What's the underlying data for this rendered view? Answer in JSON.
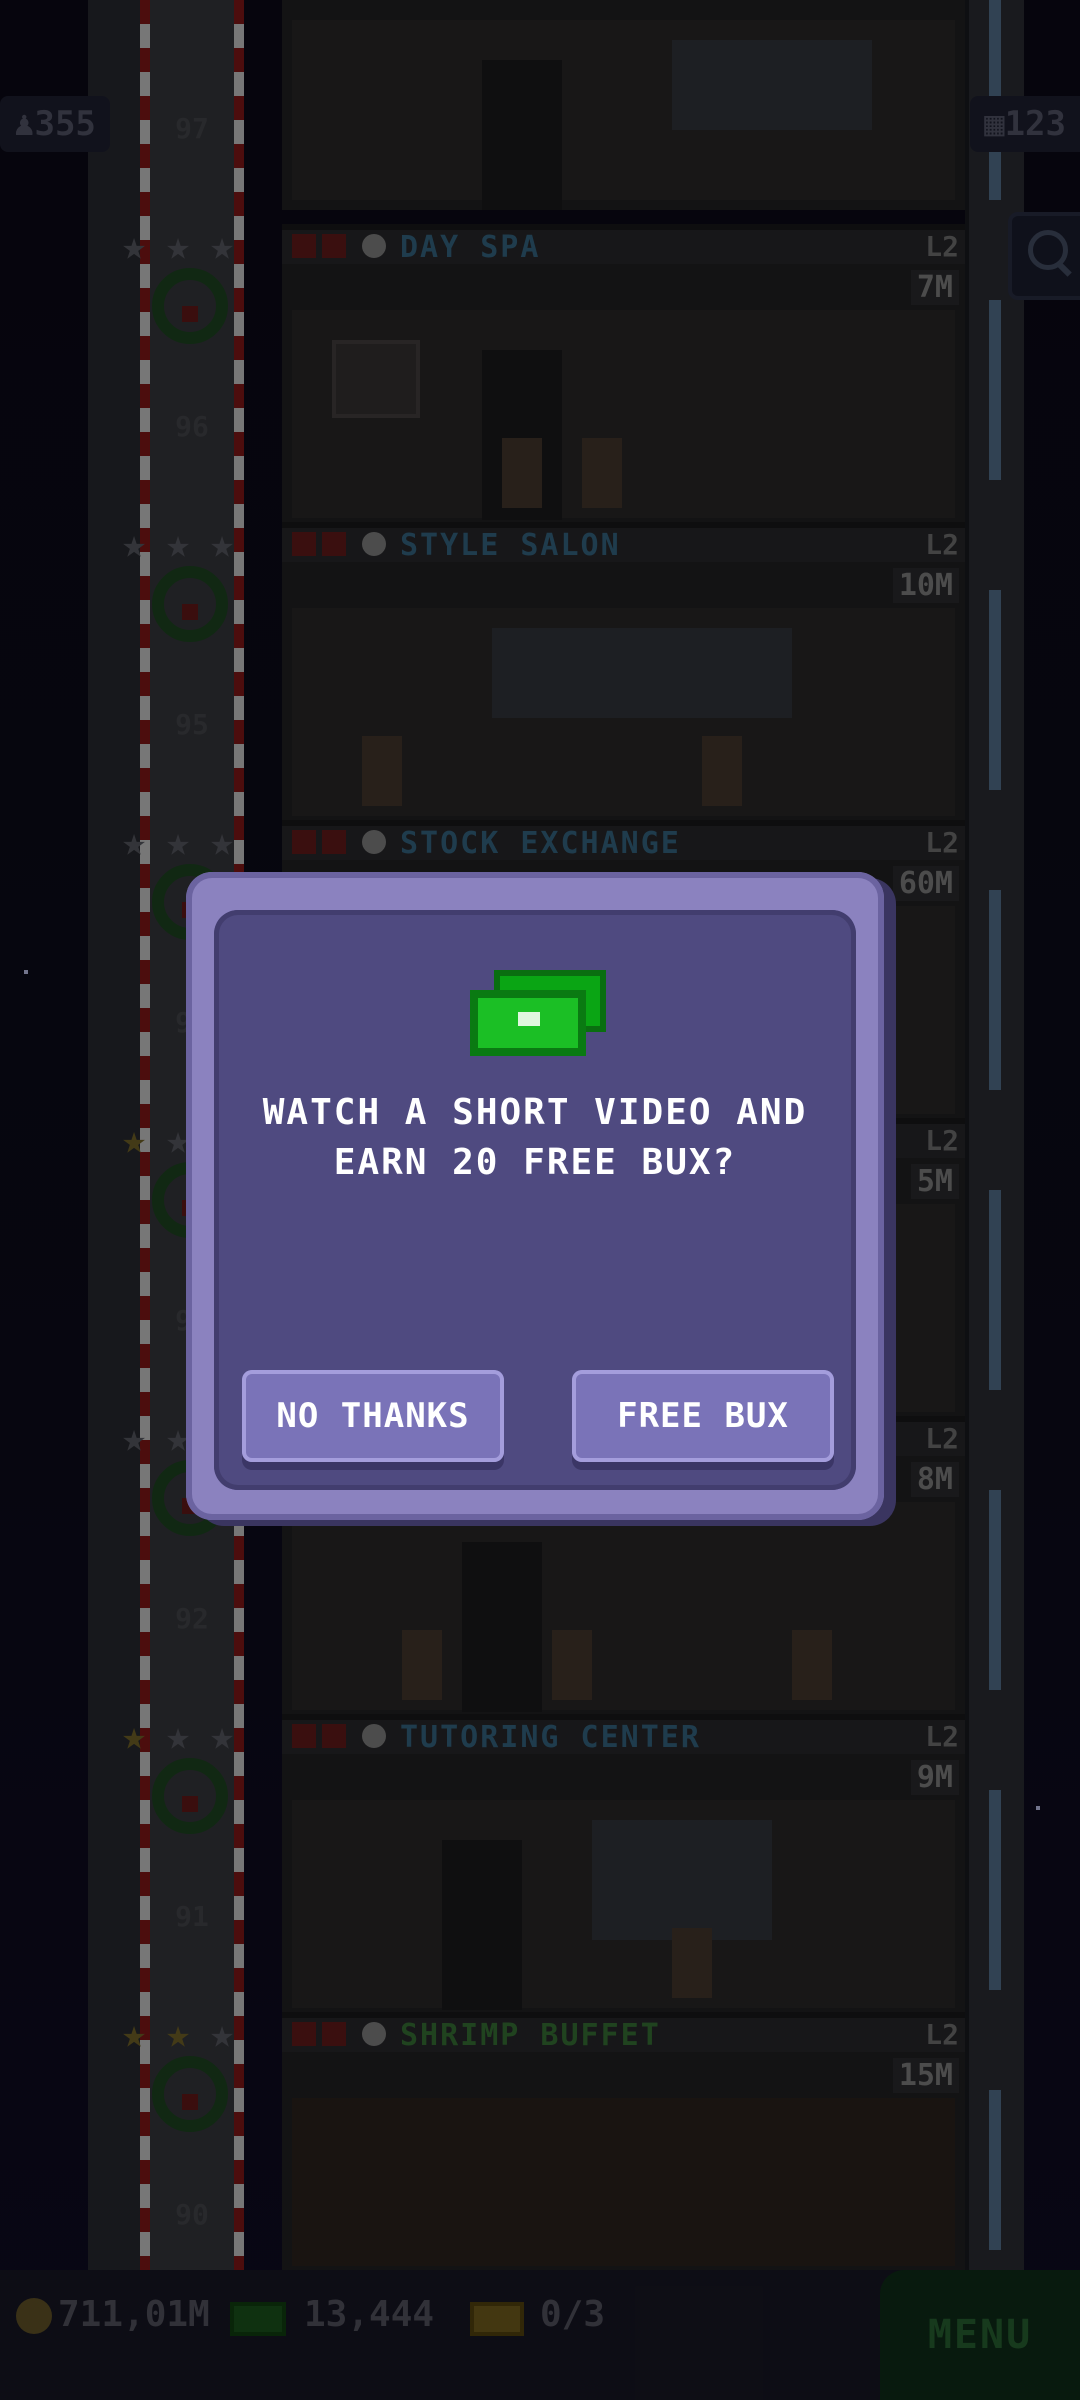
{
  "hud": {
    "population": "355",
    "floors_count": "123"
  },
  "floors": [
    {
      "number": "96",
      "name": "DAY SPA",
      "level": "L2",
      "income": "7M",
      "stars": [
        "gray",
        "gray",
        "gray"
      ],
      "color": "blue"
    },
    {
      "number": "95",
      "name": "STYLE SALON",
      "level": "L2",
      "income": "10M",
      "stars": [
        "gray",
        "gray",
        "gray"
      ],
      "color": "blue"
    },
    {
      "number": "94",
      "name": "STOCK EXCHANGE",
      "level": "L2",
      "income": "60M",
      "stars": [
        "gray",
        "gray",
        "gray"
      ],
      "color": "blue"
    },
    {
      "number": "93",
      "name": "",
      "level": "L2",
      "income": "5M",
      "stars": [
        "gold",
        "gray",
        "gray"
      ],
      "color": "blue"
    },
    {
      "number": "92",
      "name": "",
      "level": "L2",
      "income": "8M",
      "stars": [
        "gray",
        "gray",
        "gray"
      ],
      "color": "blue"
    },
    {
      "number": "91",
      "name": "TUTORING CENTER",
      "level": "L2",
      "income": "9M",
      "stars": [
        "gold",
        "gray",
        "gray"
      ],
      "color": "blue"
    },
    {
      "number": "90",
      "name": "SHRIMP BUFFET",
      "level": "L2",
      "income": "15M",
      "stars": [
        "gold",
        "gold",
        "gray"
      ],
      "color": "green"
    }
  ],
  "top_floor_number": "97",
  "dialog": {
    "message_line1": "WATCH A SHORT VIDEO AND",
    "message_line2": "EARN 20 FREE BUX?",
    "decline_label": "NO THANKS",
    "accept_label": "FREE BUX"
  },
  "bottom": {
    "coins": "711,01M",
    "bux": "13,444",
    "tickets": "0/3",
    "menu_label": "MENU"
  },
  "colors": {
    "dialog_frame": "#8b82bf",
    "dialog_inner": "#4f4a80",
    "button": "#7a73b8",
    "bux_green": "#1bbf25"
  }
}
